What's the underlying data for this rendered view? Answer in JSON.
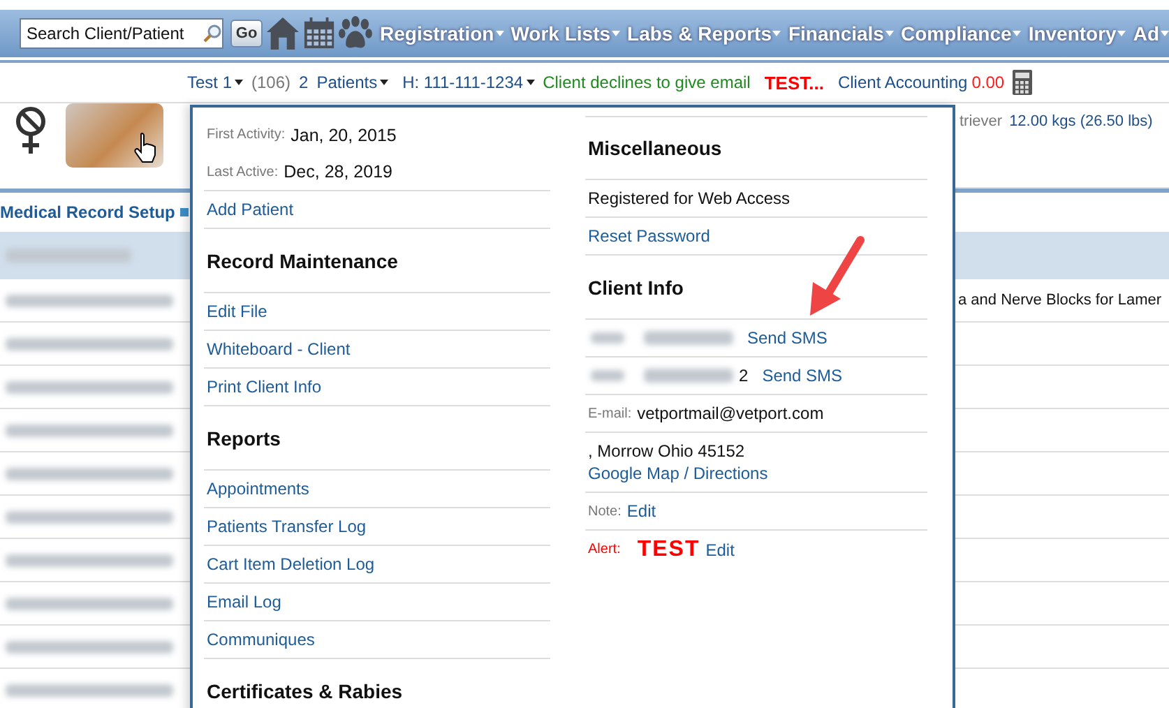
{
  "search": {
    "placeholder": "Search Client/Patient"
  },
  "go_button": "Go",
  "menu": [
    {
      "label": "Registration"
    },
    {
      "label": "Work Lists"
    },
    {
      "label": "Labs & Reports"
    },
    {
      "label": "Financials"
    },
    {
      "label": "Compliance"
    },
    {
      "label": "Inventory"
    },
    {
      "label": "Ad"
    }
  ],
  "client_bar": {
    "client": "Test 1",
    "count": "(106)",
    "patients_count": "2",
    "patients": "Patients",
    "phone": "H: 111-111-1234",
    "email_note": "Client declines to give email",
    "alert": "TEST...",
    "accounting": "Client Accounting",
    "balance": "0.00"
  },
  "patient": {
    "breed": "triever",
    "weight": "12.00 kgs (26.50 lbs)"
  },
  "section_tab": "Medical Record Setup",
  "record_text": "a and Nerve Blocks for Lamer",
  "dropdown": {
    "left": [
      {
        "kind": "date",
        "label": "First Activity:",
        "value": "Jan, 20, 2015"
      },
      {
        "kind": "date",
        "label": "Last Active:",
        "value": "Dec, 28, 2019"
      },
      {
        "kind": "link",
        "text": "Add Patient"
      },
      {
        "kind": "heading",
        "text": "Record Maintenance"
      },
      {
        "kind": "link",
        "text": "Edit File"
      },
      {
        "kind": "link",
        "text": "Whiteboard - Client"
      },
      {
        "kind": "link",
        "text": "Print Client Info"
      },
      {
        "kind": "heading",
        "text": "Reports"
      },
      {
        "kind": "link",
        "text": "Appointments"
      },
      {
        "kind": "link",
        "text": "Patients Transfer Log"
      },
      {
        "kind": "link",
        "text": "Cart Item Deletion Log"
      },
      {
        "kind": "link",
        "text": "Email Log"
      },
      {
        "kind": "link",
        "text": "Communiques"
      },
      {
        "kind": "heading",
        "text": "Certificates & Rabies"
      }
    ],
    "right": [
      {
        "kind": "heading",
        "text": "Miscellaneous"
      },
      {
        "kind": "text",
        "text": "Registered for Web Access"
      },
      {
        "kind": "link",
        "text": "Reset Password"
      },
      {
        "kind": "heading",
        "text": "Client Info"
      },
      {
        "kind": "phone",
        "link": "Send SMS"
      },
      {
        "kind": "phone",
        "suffix": "2",
        "link": "Send SMS"
      },
      {
        "kind": "email",
        "label": "E-mail:",
        "value": "vetportmail@vetport.com"
      },
      {
        "kind": "address",
        "text": ", Morrow Ohio 45152",
        "link": "Google Map / Directions"
      },
      {
        "kind": "note",
        "label": "Note:",
        "link": "Edit"
      },
      {
        "kind": "alert",
        "label": "Alert:",
        "value": "TEST",
        "link": "Edit"
      }
    ]
  }
}
